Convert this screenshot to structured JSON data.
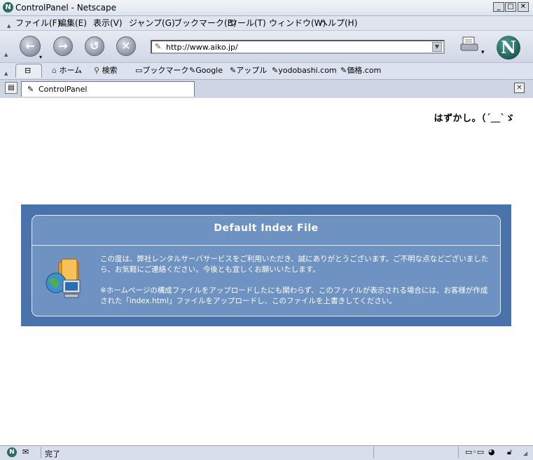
{
  "window": {
    "title": "ControlPanel - Netscape"
  },
  "menu": [
    "ファイル(F)",
    "編集(E)",
    "表示(V)",
    "ジャンプ(G)",
    "ブックマーク(B)",
    "ツール(T)",
    "ウィンドウ(W)",
    "ヘルプ(H)"
  ],
  "nav": {
    "url": "http://www.aiko.jp/"
  },
  "personal_toolbar": {
    "home": "ホーム",
    "search": "検索",
    "bookmarks": "ブックマーク",
    "links": [
      "Google",
      "アップル",
      "yodobashi.com",
      "価格.com"
    ]
  },
  "tab": {
    "label": "ControlPanel"
  },
  "page": {
    "corner_text": "はずかし。（´＿`ゞ",
    "box_title": "Default Index File",
    "paragraph1": "この度は、弊社レンタルサーバサービスをご利用いただき、誠にありがとうございます。ご不明な点などございましたら、お気軽にご連絡ください。今後とも宜しくお願いいたします。",
    "paragraph2": "※ホームページの構成ファイルをアップロードしたにも関わらず、このファイルが表示される場合には、お客様が作成された「index.html」ファイルをアップロードし、このファイルを上書きしてください。"
  },
  "status": {
    "text": "完了"
  }
}
